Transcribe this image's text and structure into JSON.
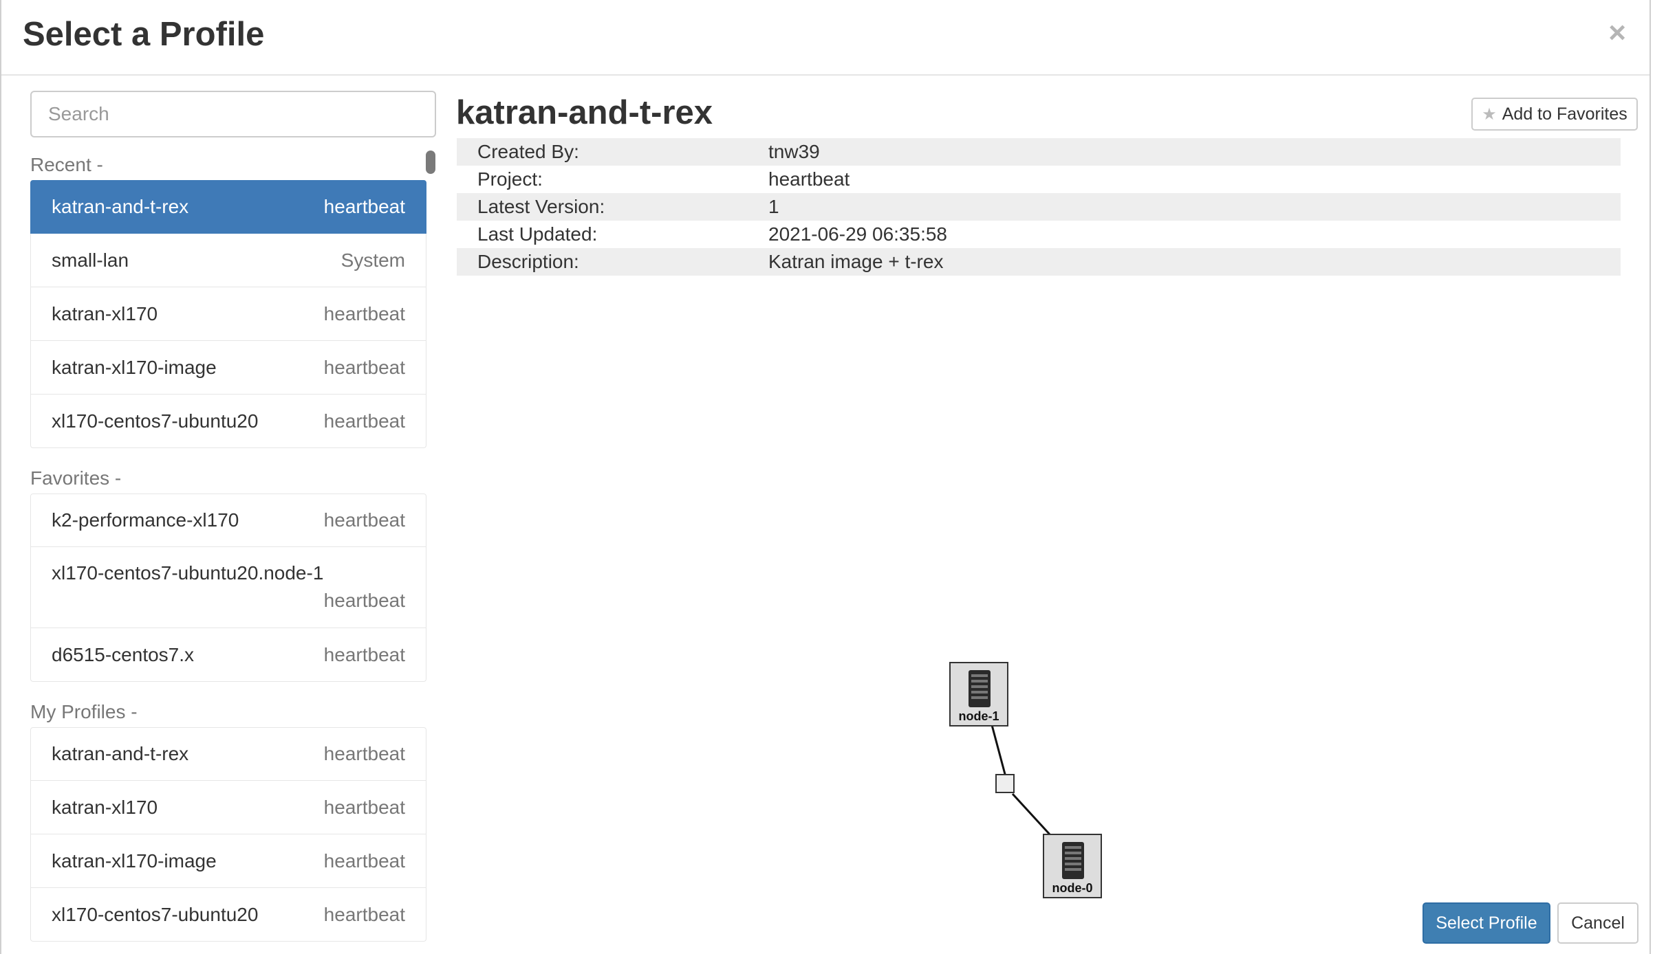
{
  "dialog": {
    "title": "Select a Profile",
    "close_label": "×"
  },
  "search": {
    "placeholder": "Search",
    "value": ""
  },
  "groups": {
    "recent": {
      "label": "Recent -",
      "items": [
        {
          "name": "katran-and-t-rex",
          "project": "heartbeat",
          "selected": true
        },
        {
          "name": "small-lan",
          "project": "System"
        },
        {
          "name": "katran-xl170",
          "project": "heartbeat"
        },
        {
          "name": "katran-xl170-image",
          "project": "heartbeat"
        },
        {
          "name": "xl170-centos7-ubuntu20",
          "project": "heartbeat"
        }
      ]
    },
    "favorites": {
      "label": "Favorites -",
      "items": [
        {
          "name": "k2-performance-xl170",
          "project": "heartbeat"
        },
        {
          "name": "xl170-centos7-ubuntu20.node-1",
          "project": "heartbeat"
        },
        {
          "name": "d6515-centos7.x",
          "project": "heartbeat"
        }
      ]
    },
    "my_profiles": {
      "label": "My Profiles -",
      "items": [
        {
          "name": "katran-and-t-rex",
          "project": "heartbeat"
        },
        {
          "name": "katran-xl170",
          "project": "heartbeat"
        },
        {
          "name": "katran-xl170-image",
          "project": "heartbeat"
        },
        {
          "name": "xl170-centos7-ubuntu20",
          "project": "heartbeat"
        }
      ]
    }
  },
  "details": {
    "name": "katran-and-t-rex",
    "favorite_button": "Add to Favorites",
    "favorite_icon": "star-icon",
    "rows": [
      {
        "key": "Created By:",
        "value": "tnw39"
      },
      {
        "key": "Project:",
        "value": "heartbeat"
      },
      {
        "key": "Latest Version:",
        "value": "1"
      },
      {
        "key": "Last Updated:",
        "value": "2021-06-29 06:35:58"
      },
      {
        "key": "Description:",
        "value": "Katran image + t-rex"
      }
    ]
  },
  "topology": {
    "nodes": [
      {
        "label": "node-1",
        "icon": "server-icon"
      },
      {
        "label": "node-0",
        "icon": "server-icon"
      }
    ]
  },
  "footer": {
    "select_label": "Select Profile",
    "cancel_label": "Cancel"
  },
  "colors": {
    "selected_bg": "#3f7ab7",
    "primary_button": "#3f7fb2"
  }
}
